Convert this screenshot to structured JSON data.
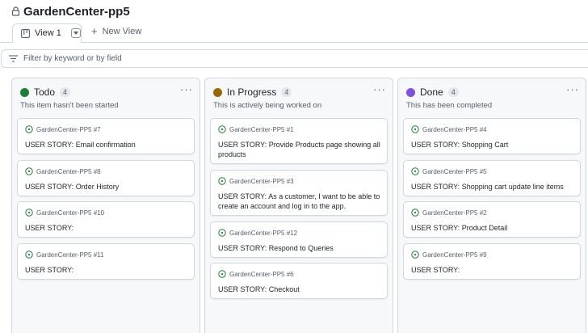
{
  "header": {
    "title": "GardenCenter-pp5",
    "lock_icon": "lock-icon"
  },
  "tabs": {
    "active": {
      "label": "View 1",
      "icon": "table-board-icon"
    },
    "new_view": "New View"
  },
  "filter": {
    "placeholder": "Filter by keyword or by field",
    "icon": "filter-icon"
  },
  "colors": {
    "todo": "#1a7f37",
    "in_progress": "#9a6700",
    "done": "#8250df",
    "issue_open": "#1a7f37"
  },
  "columns": [
    {
      "title": "Todo",
      "count": "4",
      "description": "This item hasn't been started",
      "cards": [
        {
          "ref": "GardenCenter-PP5 #7",
          "title": "USER STORY: Email confirmation"
        },
        {
          "ref": "GardenCenter-PP5 #8",
          "title": "USER STORY: Order History"
        },
        {
          "ref": "GardenCenter-PP5 #10",
          "title": "USER STORY:"
        },
        {
          "ref": "GardenCenter-PP5 #11",
          "title": "USER STORY:"
        }
      ]
    },
    {
      "title": "In Progress",
      "count": "4",
      "description": "This is actively being worked on",
      "cards": [
        {
          "ref": "GardenCenter-PP5 #1",
          "title": "USER STORY: Provide Products page showing all products"
        },
        {
          "ref": "GardenCenter-PP5 #3",
          "title": "USER STORY: As a customer, I want to be able to create an account and log in to the app."
        },
        {
          "ref": "GardenCenter-PP5 #12",
          "title": "USER STORY: Respond to Queries"
        },
        {
          "ref": "GardenCenter-PP5 #6",
          "title": "USER STORY: Checkout"
        }
      ]
    },
    {
      "title": "Done",
      "count": "4",
      "description": "This has been completed",
      "cards": [
        {
          "ref": "GardenCenter-PP5 #4",
          "title": "USER STORY: Shopping Cart"
        },
        {
          "ref": "GardenCenter-PP5 #5",
          "title": "USER STORY: Shopping cart update line items"
        },
        {
          "ref": "GardenCenter-PP5 #2",
          "title": "USER STORY: Product Detail"
        },
        {
          "ref": "GardenCenter-PP5 #9",
          "title": "USER STORY:"
        }
      ]
    }
  ]
}
